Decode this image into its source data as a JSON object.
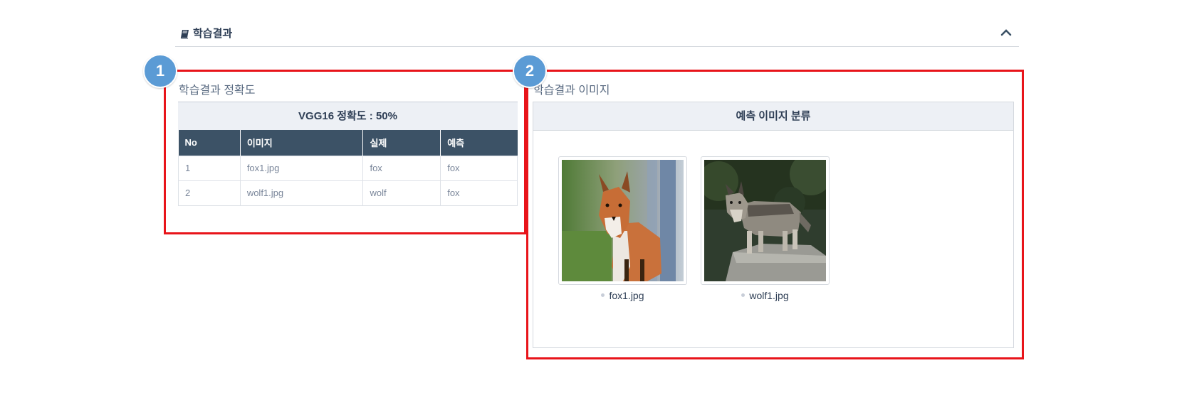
{
  "section": {
    "title": "학습결과",
    "icon": "book-icon",
    "collapse_icon": "chevron-up-icon"
  },
  "badges": [
    "1",
    "2"
  ],
  "accuracy_panel": {
    "title": "학습결과 정확도",
    "caption": "VGG16 정확도 : 50%",
    "columns": [
      "No",
      "이미지",
      "실제",
      "예측"
    ],
    "rows": [
      {
        "no": "1",
        "image": "fox1.jpg",
        "actual": "fox",
        "predicted": "fox"
      },
      {
        "no": "2",
        "image": "wolf1.jpg",
        "actual": "wolf",
        "predicted": "fox"
      }
    ]
  },
  "image_panel": {
    "title": "학습결과 이미지",
    "caption": "예측 이미지 분류",
    "images": [
      {
        "file": "fox1.jpg",
        "depicts": "fox"
      },
      {
        "file": "wolf1.jpg",
        "depicts": "wolf"
      }
    ]
  },
  "colors": {
    "highlight": "#e8141a",
    "badge": "#5b9bd5",
    "table_header": "#3c5266",
    "caption_bg": "#edf0f5"
  }
}
